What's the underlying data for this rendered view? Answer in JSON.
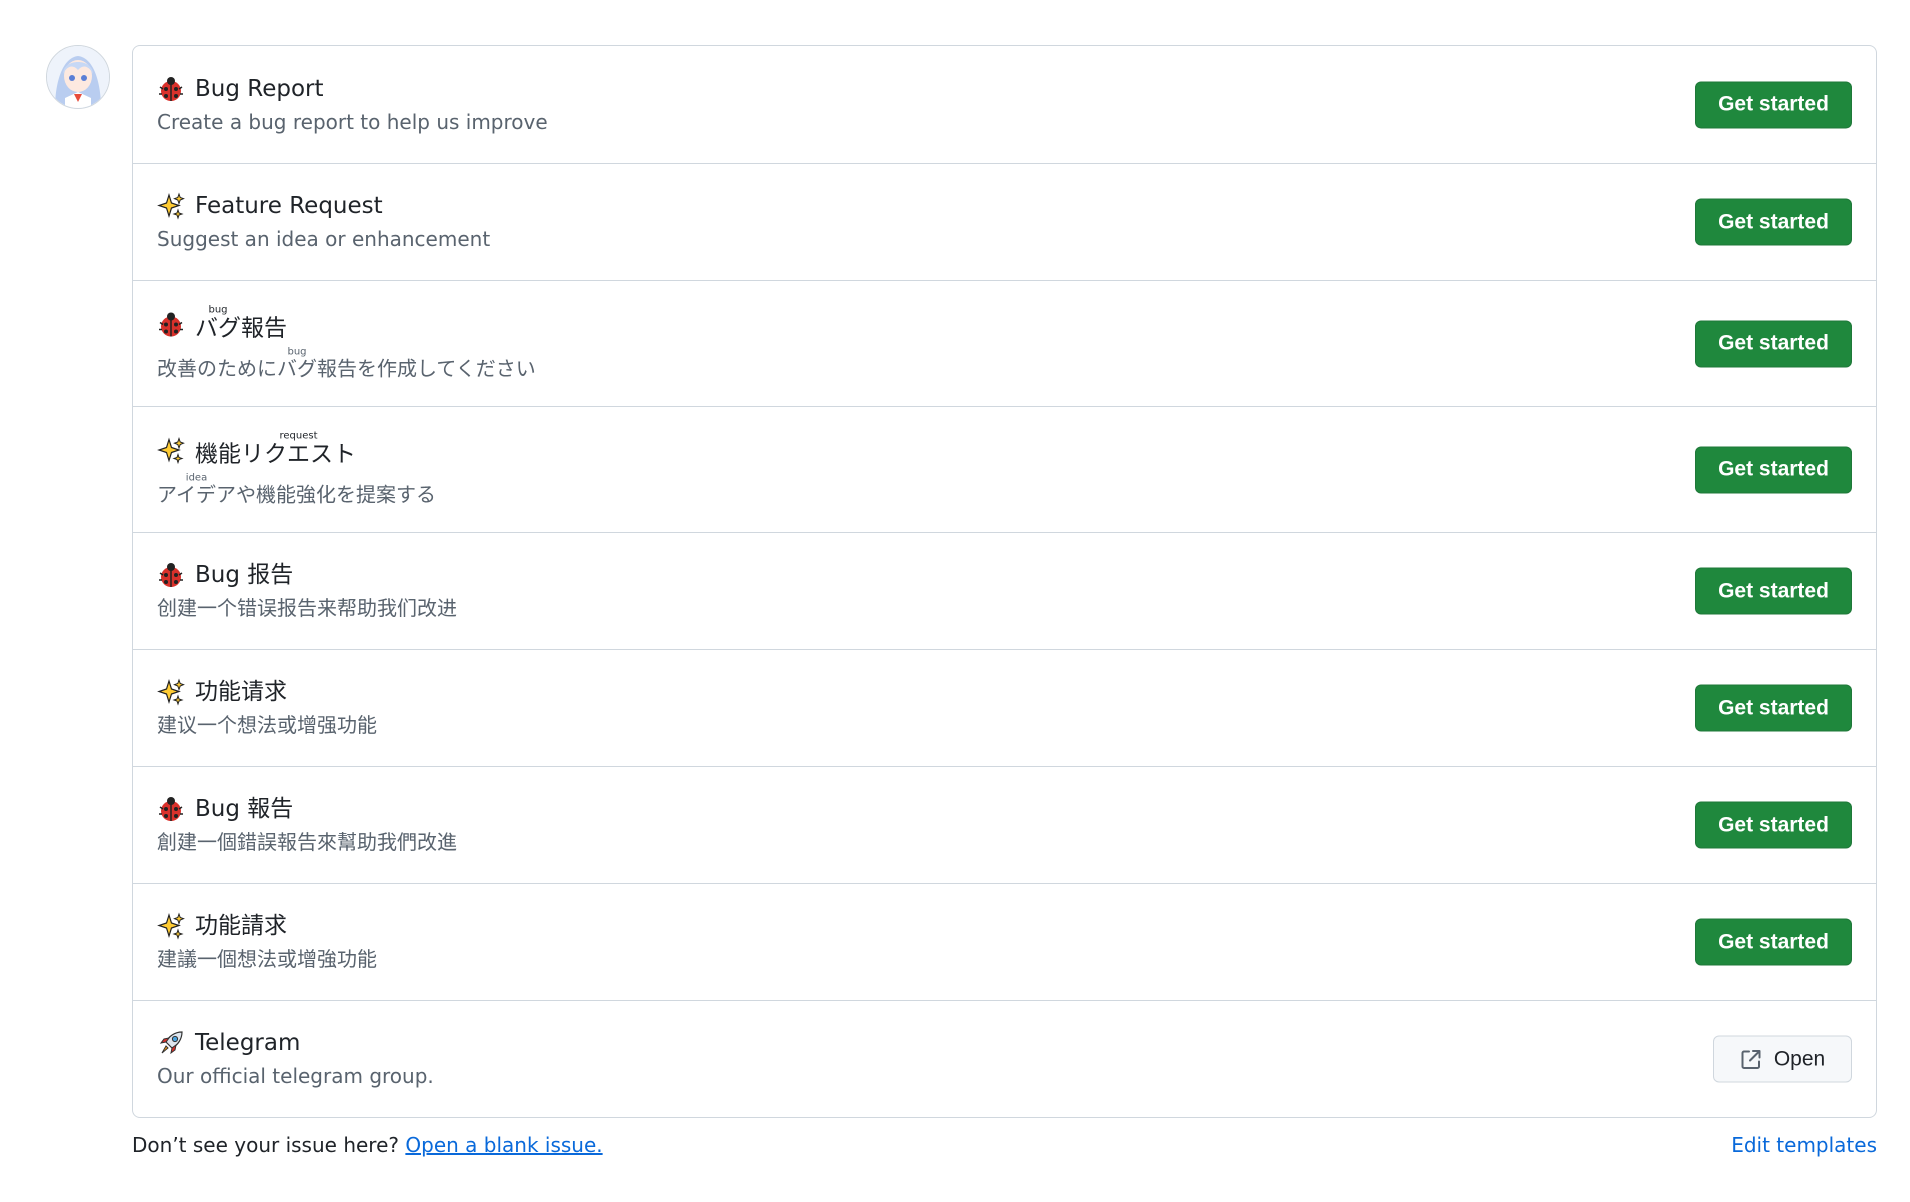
{
  "templates": [
    {
      "icon": "ladybug-icon",
      "title": "Bug Report",
      "description": "Create a bug report to help us improve",
      "button": "Get started"
    },
    {
      "icon": "sparkles-icon",
      "title": "Feature Request",
      "description": "Suggest an idea or enhancement",
      "button": "Get started"
    },
    {
      "icon": "ladybug-icon",
      "title_pre": "",
      "title_ruby": "バグ",
      "title_rt": "bug",
      "title_post": "報告",
      "desc_pre": "改善のために",
      "desc_ruby": "バグ",
      "desc_rt": "bug",
      "desc_post": "報告を作成してください",
      "button": "Get started"
    },
    {
      "icon": "sparkles-icon",
      "title_pre": "機能",
      "title_ruby": "リクエスト",
      "title_rt": "request",
      "title_post": "",
      "desc_pre": "",
      "desc_ruby": "アイデア",
      "desc_rt": "idea",
      "desc_post": "や機能強化を提案する",
      "button": "Get started"
    },
    {
      "icon": "ladybug-icon",
      "title": "Bug 报告",
      "description": "创建一个错误报告来帮助我们改进",
      "button": "Get started"
    },
    {
      "icon": "sparkles-icon",
      "title": "功能请求",
      "description": "建议一个想法或增强功能",
      "button": "Get started"
    },
    {
      "icon": "ladybug-icon",
      "title": "Bug 報告",
      "description": "創建一個錯誤報告來幫助我們改進",
      "button": "Get started"
    },
    {
      "icon": "sparkles-icon",
      "title": "功能請求",
      "description": "建議一個想法或增強功能",
      "button": "Get started"
    },
    {
      "icon": "rocket-icon",
      "title": "Telegram",
      "description": "Our official telegram group.",
      "button": "Open",
      "button_icon": "external-link-icon"
    }
  ],
  "footer": {
    "prompt": "Don’t see your issue here?",
    "blank_issue_link": "Open a blank issue.",
    "edit_templates_link": "Edit templates"
  },
  "colors": {
    "primary_button": "#1f883d",
    "link": "#0969da",
    "border": "#d0d7de",
    "muted_text": "#59636e"
  }
}
